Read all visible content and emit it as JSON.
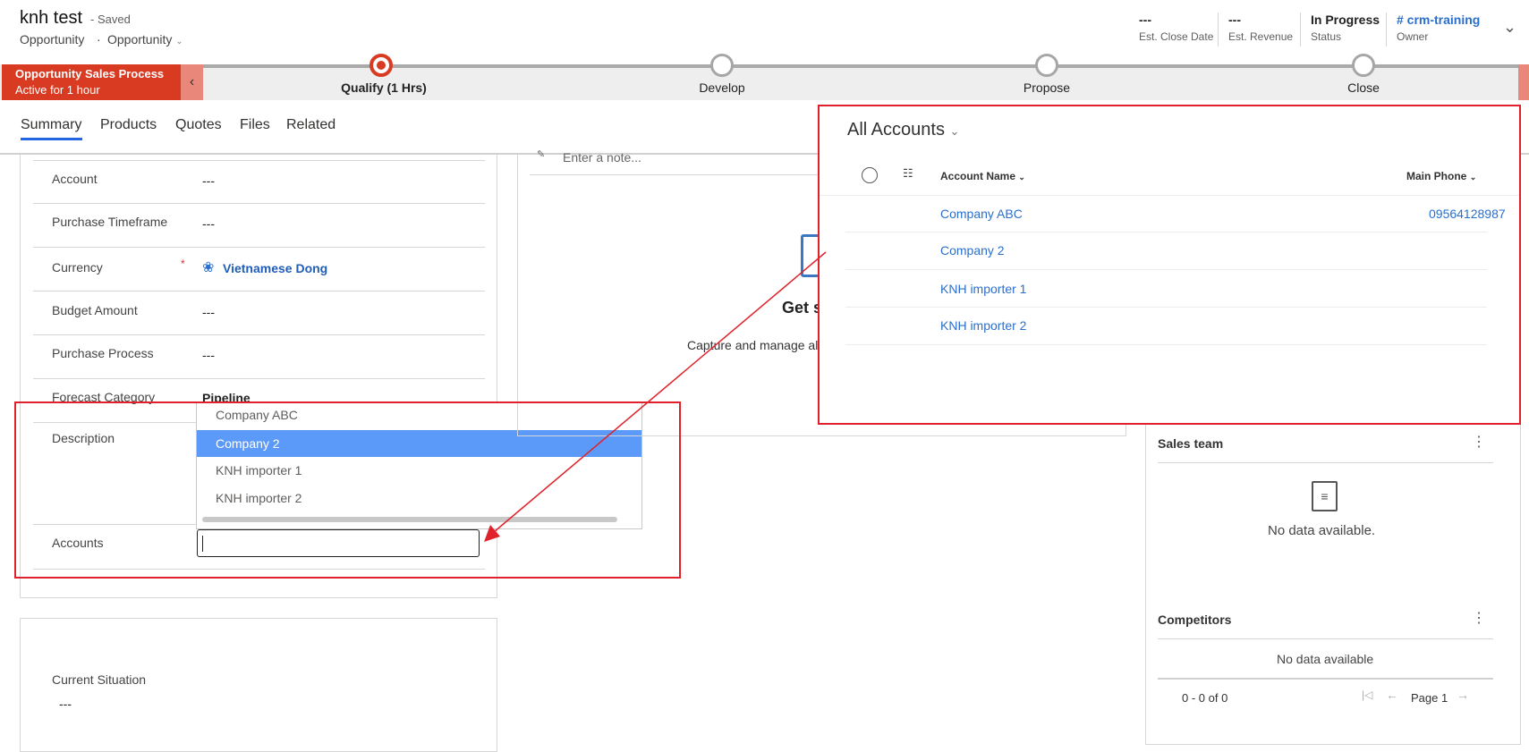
{
  "header": {
    "title": "knh test",
    "saved": "- Saved",
    "entity": "Opportunity",
    "form": "Opportunity",
    "fields": [
      {
        "value": "---",
        "label": "Est. Close Date"
      },
      {
        "value": "---",
        "label": "Est. Revenue"
      },
      {
        "value": "In Progress",
        "label": "Status"
      },
      {
        "value": "# crm-training",
        "label": "Owner"
      }
    ]
  },
  "process": {
    "name": "Opportunity Sales Process",
    "active": "Active for 1 hour",
    "stages": [
      "Qualify  (1 Hrs)",
      "Develop",
      "Propose",
      "Close"
    ],
    "accent": "#d83b22"
  },
  "tabs": [
    "Summary",
    "Products",
    "Quotes",
    "Files",
    "Related"
  ],
  "form": {
    "rows": [
      {
        "label": "Account",
        "value": "---"
      },
      {
        "label": "Purchase Timeframe",
        "value": "---"
      },
      {
        "label": "Currency",
        "value": "Vietnamese Dong",
        "required": "*"
      },
      {
        "label": "Budget Amount",
        "value": "---"
      },
      {
        "label": "Purchase Process",
        "value": "---"
      },
      {
        "label": "Forecast Category",
        "value": "Pipeline"
      },
      {
        "label": "Description",
        "value": ""
      },
      {
        "label": "Accounts",
        "value": ""
      }
    ],
    "current_situation": {
      "label": "Current Situation",
      "value": "---"
    }
  },
  "dropdown": {
    "options": [
      "Company ABC",
      "Company 2",
      "KNH importer 1",
      "KNH importer 2"
    ],
    "highlighted": "Company 2"
  },
  "timeline": {
    "note_placeholder": "Enter a note...",
    "empty_title": "Get s",
    "empty_text": "Capture and manage all"
  },
  "accounts_panel": {
    "title": "All Accounts",
    "columns": [
      "Account Name",
      "Main Phone"
    ],
    "rows": [
      {
        "name": "Company ABC",
        "phone": "09564128987"
      },
      {
        "name": "Company 2",
        "phone": ""
      },
      {
        "name": "KNH importer 1",
        "phone": ""
      },
      {
        "name": "KNH importer 2",
        "phone": ""
      }
    ]
  },
  "sales_team": {
    "title": "Sales team",
    "empty": "No data available."
  },
  "competitors": {
    "title": "Competitors",
    "empty": "No data available",
    "range": "0 - 0 of 0",
    "page": "Page 1"
  }
}
